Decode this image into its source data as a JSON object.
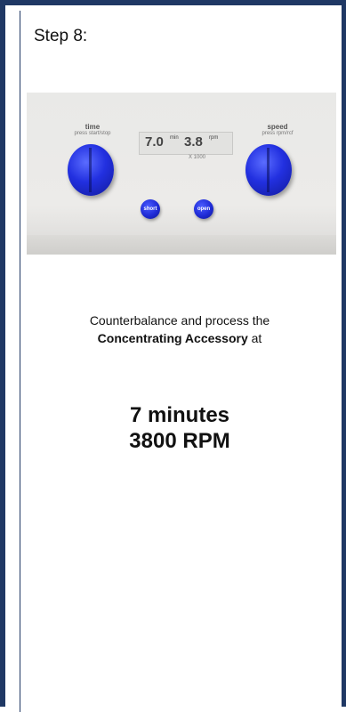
{
  "step": {
    "title": "Step 8:"
  },
  "photo": {
    "time_label": "time",
    "time_sub": "press start/stop",
    "speed_label": "speed",
    "speed_sub": "press rpm/rcf",
    "display_time": "7.0",
    "display_time_unit": "min",
    "display_speed": "3.8",
    "display_speed_unit": "rpm",
    "display_multiplier": "X 1000",
    "short_button": "short",
    "open_button": "open",
    "knob_color": "#2230e0"
  },
  "instruction": {
    "line1": "Counterbalance and process the",
    "bold": "Concentrating Accessory",
    "suffix": " at"
  },
  "settings": {
    "time": "7 minutes",
    "speed": "3800 RPM"
  },
  "colors": {
    "frame": "#1f3864"
  }
}
